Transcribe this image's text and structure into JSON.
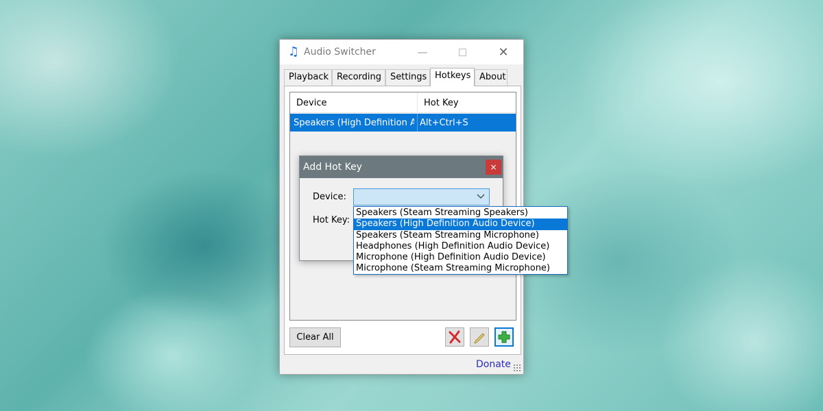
{
  "window": {
    "title": "Audio Switcher",
    "minimize_glyph": "—",
    "close_glyph": "✕"
  },
  "tabs": [
    "Playback",
    "Recording",
    "Settings",
    "Hotkeys",
    "About"
  ],
  "active_tab": "Hotkeys",
  "hotkeys_table": {
    "columns": [
      "Device",
      "Hot Key"
    ],
    "rows": [
      {
        "device": "Speakers (High Definition A...",
        "hotkey": "Alt+Ctrl+S",
        "selected": true
      }
    ]
  },
  "buttons": {
    "clear_all": "Clear All"
  },
  "donate_link": "Donate",
  "dialog": {
    "title": "Add Hot Key",
    "close_glyph": "×",
    "device_label": "Device:",
    "hotkey_label": "Hot Key:",
    "device_value": "",
    "options": [
      "Speakers (Steam Streaming Speakers)",
      "Speakers (High Definition Audio Device)",
      "Speakers (Steam Streaming Microphone)",
      "Headphones (High Definition Audio Device)",
      "Microphone (High Definition Audio Device)",
      "Microphone (Steam Streaming Microphone)"
    ],
    "highlighted_option": "Speakers (High Definition Audio Device)"
  },
  "colors": {
    "selection": "#0a78d7",
    "dialog_titlebar": "#6c7a7f",
    "dialog_close": "#c93b3b",
    "link": "#2a2ab8"
  },
  "icons": {
    "app": "music-note-icon",
    "delete": "red-x-icon",
    "edit": "pencil-icon",
    "add": "green-plus-icon",
    "dropdown": "chevron-down-icon"
  }
}
